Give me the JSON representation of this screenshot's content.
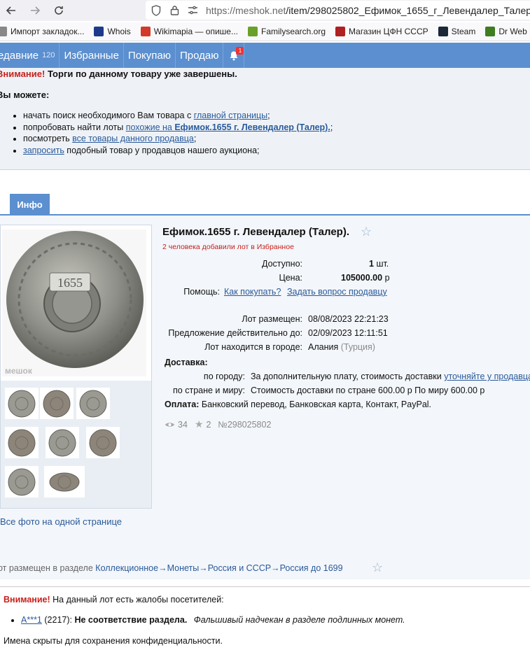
{
  "browser": {
    "url_host": "https://meshok.net",
    "url_path": "/item/298025802_Ефимок_1655_г_Левендалер_Талер",
    "bookmarks": [
      {
        "label": "Импорт закладок...",
        "icon": "folder-icon",
        "color": "#888888"
      },
      {
        "label": "Whois",
        "icon": "whois-icon",
        "color": "#1d3a8a"
      },
      {
        "label": "Wikimapia — опише...",
        "icon": "wikimapia-icon",
        "color": "#d23a2a"
      },
      {
        "label": "Familysearch.org",
        "icon": "familysearch-icon",
        "color": "#6aa12a"
      },
      {
        "label": "Магазин ЦФН СССР",
        "icon": "shop-icon",
        "color": "#b02020"
      },
      {
        "label": "Steam",
        "icon": "steam-icon",
        "color": "#1b2838"
      },
      {
        "label": "Dr Web",
        "icon": "drweb-icon",
        "color": "#3f7d20"
      }
    ]
  },
  "nav": {
    "items": [
      {
        "label": "едавние",
        "count": "120"
      },
      {
        "label": "Избранные"
      },
      {
        "label": "Покупаю"
      },
      {
        "label": "Продаю"
      }
    ],
    "notif_count": "1"
  },
  "warning": {
    "attention": "Внимание!",
    "message": "Торги по данному товару уже завершены.",
    "you_can": "Вы можете:",
    "items": [
      {
        "pre": "начать поиск необходимого Вам товара с ",
        "link": "главной страницы",
        "post": ";"
      },
      {
        "pre": "попробовать найти лоты ",
        "link": "похожие на ",
        "link_bold": "Ефимок.1655 г. Левендалер (Талер).",
        "post": ";"
      },
      {
        "pre": "посмотреть ",
        "link": "все товары данного продавца",
        "post": ";"
      },
      {
        "pre": "",
        "link": "запросить",
        "post": " подобный товар у продавцов нашего аукциона;"
      }
    ]
  },
  "tab": {
    "label": "Инфо"
  },
  "lot": {
    "title": "Ефимок.1655 г. Левендалер (Талер).",
    "favorites_note": "2 человека добавили лот в Избранное",
    "available_label": "Доступно:",
    "available_value": "1",
    "available_unit": "шт.",
    "price_label": "Цена:",
    "price_value": "105000.00",
    "price_unit": "р",
    "help_label": "Помощь:",
    "help_link1": "Как покупать?",
    "help_link2": "Задать вопрос продавцу",
    "placed_label": "Лот размещен:",
    "placed_value": "08/08/2023 22:21:23",
    "valid_label": "Предложение действительно до:",
    "valid_value": "02/09/2023 12:11:51",
    "city_label": "Лот находится в городе:",
    "city_value": "Алания",
    "country_value": "(Турция)",
    "delivery_label": "Доставка:",
    "by_city_label": "по городу:",
    "by_city_text": "За дополнительную плату, стоимость доставки ",
    "by_city_link": "уточняйте у продавца",
    "by_country_label": "по стране и миру:",
    "by_country_text": "Стоимость доставки по стране 600.00 р По миру 600.00 р",
    "payment_label": "Оплата:",
    "payment_value": "Банковский перевод, Банковская карта, Контакт, PayPal.",
    "views": "34",
    "favs": "2",
    "lot_number": "№298025802",
    "watermark": "мешок",
    "coin_year": "1655",
    "all_photos": "Все фото на одной странице"
  },
  "category": {
    "prefix": "от размещен в разделе",
    "path": [
      "Коллекционное",
      "Монеты",
      "Россия и СССР",
      "Россия до 1699"
    ]
  },
  "complaints": {
    "attention": "Внимание!",
    "message": "На данный лот есть жалобы посетителей:",
    "user": "A***1",
    "user_rating": "(2217):",
    "reason": "Не соответствие раздела.",
    "comment": "Фальшивый надчекан в разделе подлинных монет.",
    "hidden_note": "Имена скрыты для сохранения конфиденциальности."
  }
}
